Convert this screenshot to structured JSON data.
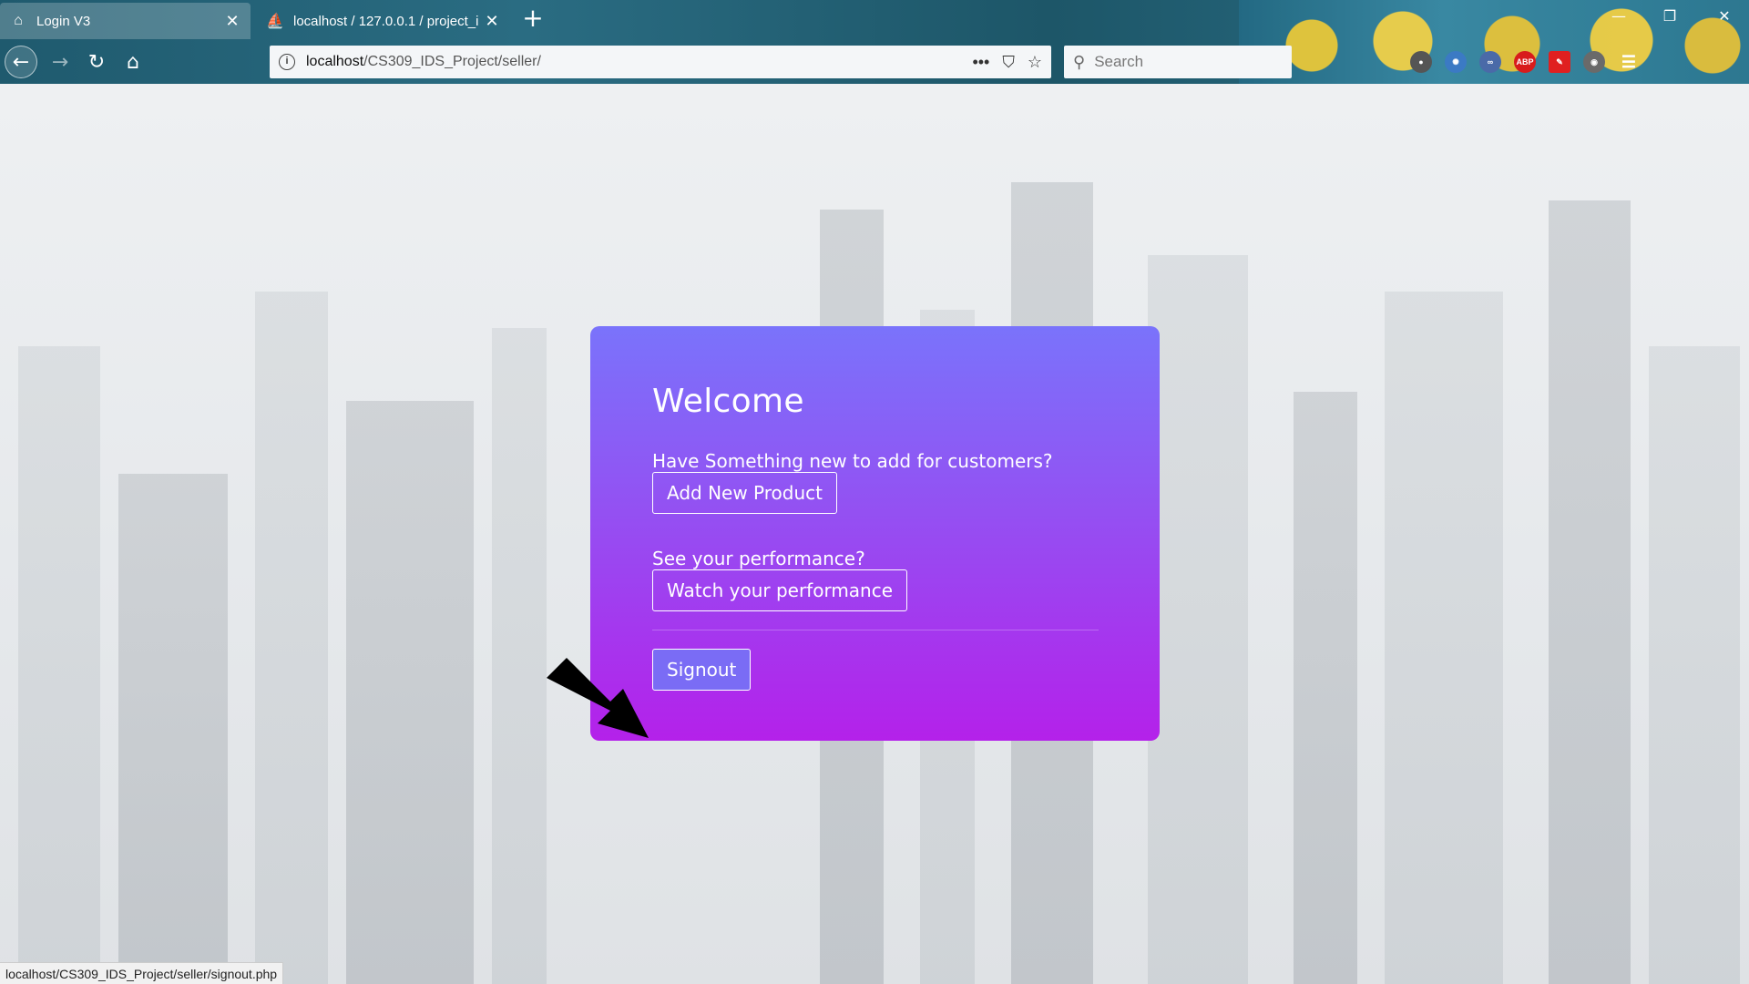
{
  "browser": {
    "tabs": [
      {
        "title": "Login V3",
        "icon": "home-icon"
      },
      {
        "title": "localhost / 127.0.0.1 / project_i",
        "icon": "phpmyadmin-icon"
      }
    ],
    "url": {
      "host": "localhost",
      "path": "/CS309_IDS_Project/seller/"
    },
    "search_placeholder": "Search",
    "extensions": [
      "ABP"
    ],
    "status_url": "localhost/CS309_IDS_Project/seller/signout.php"
  },
  "card": {
    "title": "Welcome",
    "add_prompt": "Have Something new to add for customers?",
    "add_button": "Add New Product",
    "performance_prompt": "See your performance?",
    "performance_button": "Watch your performance",
    "signout_button": "Signout"
  },
  "colors": {
    "card_top": "#7a73fb",
    "card_bottom": "#b421ea",
    "signout_bg": "#7a6cf5"
  }
}
